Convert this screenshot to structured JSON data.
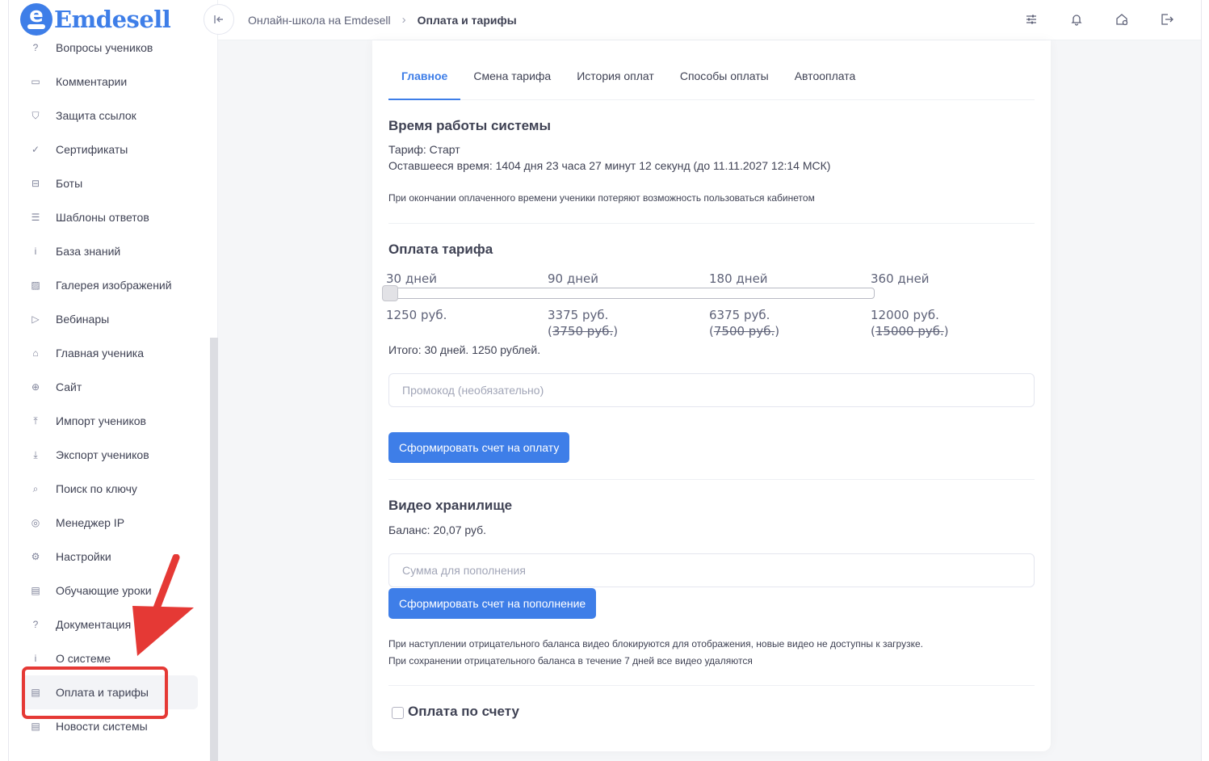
{
  "brand": {
    "logo_letter": "e",
    "name": "Emdesell",
    "accent": "#3e7ee8"
  },
  "sidebar": {
    "items": [
      {
        "icon": "question-circle-icon",
        "glyph": "?",
        "label": "Вопросы учеников"
      },
      {
        "icon": "comment-icon",
        "glyph": "▭",
        "label": "Комментарии"
      },
      {
        "icon": "shield-icon",
        "glyph": "⛉",
        "label": "Защита ссылок"
      },
      {
        "icon": "check-circle-icon",
        "glyph": "✓",
        "label": "Сертификаты"
      },
      {
        "icon": "robot-icon",
        "glyph": "⊟",
        "label": "Боты"
      },
      {
        "icon": "list-icon",
        "glyph": "☰",
        "label": "Шаблоны ответов"
      },
      {
        "icon": "info-circle-icon",
        "glyph": "i",
        "label": "База знаний"
      },
      {
        "icon": "image-icon",
        "glyph": "▨",
        "label": "Галерея изображений"
      },
      {
        "icon": "play-icon",
        "glyph": "▷",
        "label": "Вебинары"
      },
      {
        "icon": "home-icon",
        "glyph": "⌂",
        "label": "Главная ученика"
      },
      {
        "icon": "globe-icon",
        "glyph": "⊕",
        "label": "Сайт"
      },
      {
        "icon": "upload-icon",
        "glyph": "⤒",
        "label": "Импорт учеников"
      },
      {
        "icon": "download-icon",
        "glyph": "⤓",
        "label": "Экспорт учеников"
      },
      {
        "icon": "search-icon",
        "glyph": "⌕",
        "label": "Поиск по ключу"
      },
      {
        "icon": "target-icon",
        "glyph": "◎",
        "label": "Менеджер IP"
      },
      {
        "icon": "gear-icon",
        "glyph": "⚙",
        "label": "Настройки"
      },
      {
        "icon": "film-icon",
        "glyph": "▤",
        "label": "Обучающие уроки"
      },
      {
        "icon": "help-square-icon",
        "glyph": "?",
        "label": "Документация"
      },
      {
        "icon": "info-square-icon",
        "glyph": "i",
        "label": "О системе"
      },
      {
        "icon": "receipt-icon",
        "glyph": "▤",
        "label": "Оплата и тарифы"
      },
      {
        "icon": "newspaper-icon",
        "glyph": "▤",
        "label": "Новости системы"
      }
    ],
    "active_index": 19
  },
  "header": {
    "breadcrumb_parent": "Онлайн-школа на Emdesell",
    "breadcrumb_current": "Оплата и тарифы"
  },
  "tabs": [
    "Главное",
    "Смена тарифа",
    "История оплат",
    "Способы оплаты",
    "Автооплата"
  ],
  "uptime": {
    "title": "Время работы системы",
    "tariff": "Тариф: Старт",
    "remaining": "Оставшееся время: 1404 дня 23 часа 27 минут 12 секунд (до 11.11.2027 12:14 МСК)",
    "note": "При окончании оплаченного времени ученики потеряют возможность пользоваться кабинетом"
  },
  "payment": {
    "title": "Оплата тарифа",
    "periods": [
      {
        "label": "30 дней",
        "price": "1250 руб.",
        "old_price": ""
      },
      {
        "label": "90 дней",
        "price": "3375 руб.",
        "old_price": "3750 руб."
      },
      {
        "label": "180 дней",
        "price": "6375 руб.",
        "old_price": "7500 руб."
      },
      {
        "label": "360 дней",
        "price": "12000 руб.",
        "old_price": "15000 руб."
      }
    ],
    "slider_value": 0,
    "total": "Итого: 30 дней. 1250 рублей.",
    "promo_placeholder": "Промокод (необязательно)",
    "invoice_button": "Сформировать счет на оплату"
  },
  "video": {
    "title": "Видео хранилище",
    "balance": "Баланс: 20,07 руб.",
    "amount_placeholder": "Сумма для пополнения",
    "topup_button": "Сформировать счет на пополнение",
    "note1": "При наступлении отрицательного баланса видео блокируются для отображения, новые видео не доступны к загрузке.",
    "note2": "При сохранении отрицательного баланса в течение 7 дней все видео удаляются"
  },
  "invoice_pay": {
    "label": "Оплата по счету",
    "checked": false
  }
}
